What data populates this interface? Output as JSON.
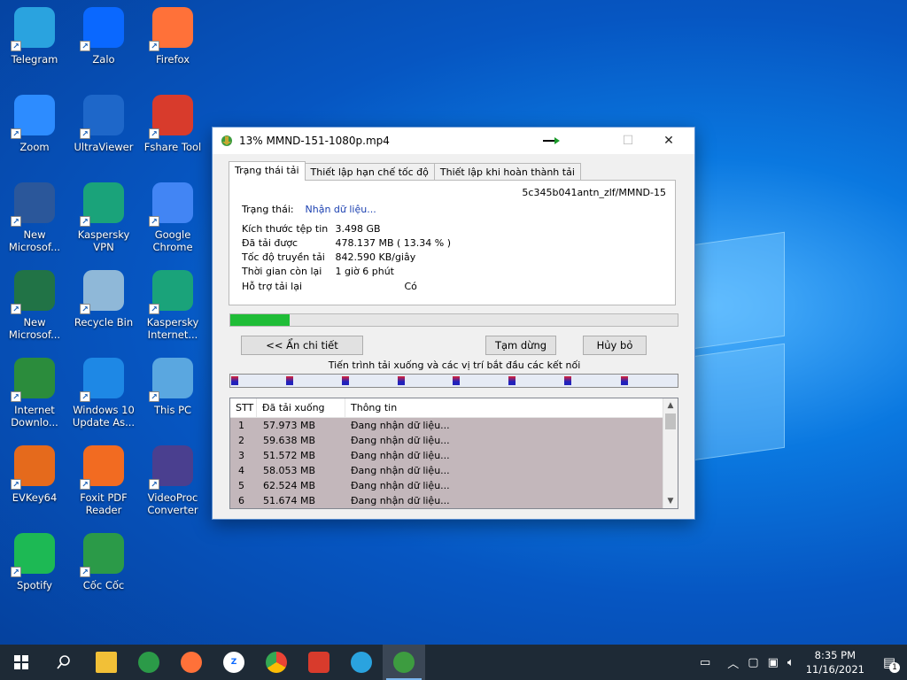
{
  "desktop": {
    "icons": [
      {
        "label": "Telegram",
        "icon": "telegram-icon",
        "color": "#2aa3df"
      },
      {
        "label": "Zalo",
        "icon": "zalo-icon",
        "color": "#0a68ff"
      },
      {
        "label": "Firefox",
        "icon": "firefox-icon",
        "color": "#ff7139"
      },
      {
        "label": "Zoom",
        "icon": "zoom-icon",
        "color": "#2d8cff"
      },
      {
        "label": "UltraViewer",
        "icon": "ultraviewer-icon",
        "color": "#1e67c9"
      },
      {
        "label": "Fshare Tool",
        "icon": "fshare-icon",
        "color": "#d83b2c"
      },
      {
        "label": "New Microsof...",
        "icon": "word-icon",
        "color": "#2b579a"
      },
      {
        "label": "Kaspersky VPN",
        "icon": "kaspersky-vpn-icon",
        "color": "#1aa37a"
      },
      {
        "label": "Google Chrome",
        "icon": "chrome-icon",
        "color": "#4285f4"
      },
      {
        "label": "New Microsof...",
        "icon": "excel-icon",
        "color": "#217346"
      },
      {
        "label": "Recycle Bin",
        "icon": "recycle-bin-icon",
        "color": "#8fb8d8"
      },
      {
        "label": "Kaspersky Internet...",
        "icon": "kaspersky-internet-icon",
        "color": "#1aa37a"
      },
      {
        "label": "Internet Downlo...",
        "icon": "idm-icon",
        "color": "#2b8c3c"
      },
      {
        "label": "Windows 10 Update As...",
        "icon": "windows-update-icon",
        "color": "#1e88e5"
      },
      {
        "label": "This PC",
        "icon": "this-pc-icon",
        "color": "#5aa7e0"
      },
      {
        "label": "EVKey64",
        "icon": "evkey-icon",
        "color": "#e56a1c"
      },
      {
        "label": "Foxit PDF Reader",
        "icon": "foxit-icon",
        "color": "#f26b21"
      },
      {
        "label": "VideoProc Converter",
        "icon": "videoproc-icon",
        "color": "#4a3f8f"
      },
      {
        "label": "Spotify",
        "icon": "spotify-icon",
        "color": "#1db954"
      },
      {
        "label": "Cốc Cốc",
        "icon": "coccoc-icon",
        "color": "#2b9a48"
      }
    ]
  },
  "window": {
    "title": "13% MMND-151-1080p.mp4",
    "tabs": [
      "Trạng thái tải",
      "Thiết lập hạn chế tốc độ",
      "Thiết lập khi hoàn thành tải"
    ],
    "url_fragment": "5c345b041antn_zlf/MMND-15",
    "status_label": "Trạng thái:",
    "status_value": "Nhận dữ liệu...",
    "fields": [
      {
        "k": "Kích thước tệp tin",
        "v": "3.498  GB"
      },
      {
        "k": "Đã tải được",
        "v": "478.137  MB  ( 13.34 % )"
      },
      {
        "k": "Tốc độ truyền tải",
        "v": "842.590  KB/giây"
      },
      {
        "k": "Thời gian còn lại",
        "v": "1 giờ 6 phút"
      },
      {
        "k": "Hỗ trợ tải lại",
        "v": "Có"
      }
    ],
    "progress": 0.1334,
    "buttons": {
      "details": "<< Ẩn chi tiết",
      "pause": "Tạm dừng",
      "cancel": "Hủy bỏ"
    },
    "connections_label": "Tiến trình tải xuống và các vị trí bắt đầu các kết nối",
    "table": {
      "headers": [
        "STT",
        "Đã tải xuống",
        "Thông tin"
      ],
      "rows": [
        [
          "1",
          "57.973  MB",
          "Đang nhận dữ liệu..."
        ],
        [
          "2",
          "59.638  MB",
          "Đang nhận dữ liệu..."
        ],
        [
          "3",
          "51.572  MB",
          "Đang nhận dữ liệu..."
        ],
        [
          "4",
          "58.053  MB",
          "Đang nhận dữ liệu..."
        ],
        [
          "5",
          "62.524  MB",
          "Đang nhận dữ liệu..."
        ],
        [
          "6",
          "51.674  MB",
          "Đang nhận dữ liệu..."
        ]
      ]
    }
  },
  "taskbar": {
    "time": "8:35 PM",
    "date": "11/16/2021",
    "notification_count": "1"
  }
}
